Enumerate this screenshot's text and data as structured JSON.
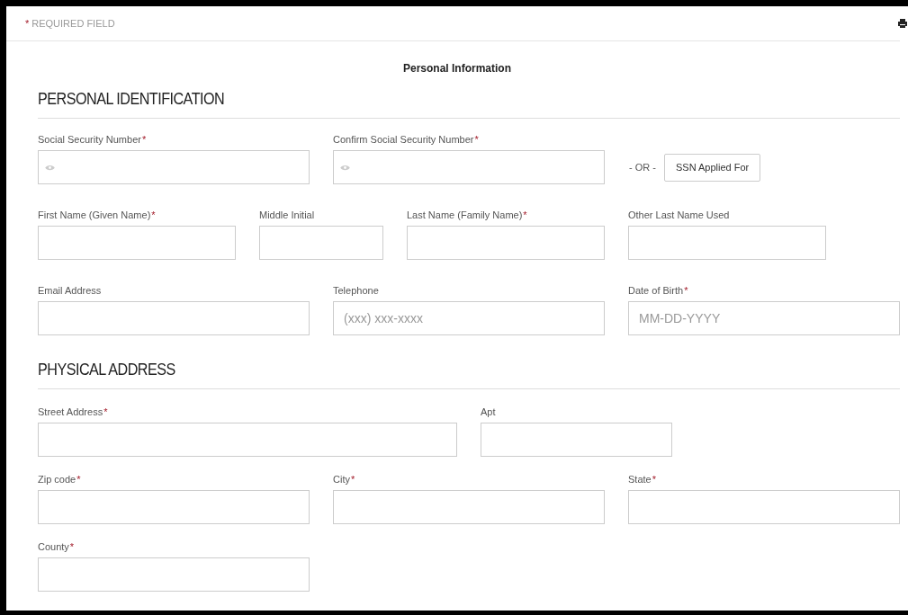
{
  "top_bar": {
    "mark": "*",
    "label": "REQUIRED FIELD"
  },
  "page_title": "Personal Information",
  "sections": [
    {
      "heading": "PERSONAL IDENTIFICATION",
      "rows": [
        [
          {
            "kind": "masked",
            "label": "Social Security Number",
            "mark": "*"
          },
          {
            "kind": "masked",
            "label": "Confirm Social Security Number",
            "mark": "*"
          },
          {
            "kind": "alternative",
            "text": "- OR -",
            "button": "SSN Applied For"
          }
        ],
        [
          {
            "kind": "field",
            "label": "First Name (Given Name)",
            "mark": "*"
          },
          {
            "kind": "field",
            "label": "Middle Initial"
          },
          {
            "kind": "field",
            "label": "Last Name (Family Name)",
            "mark": "*"
          },
          {
            "kind": "field",
            "label": "Other Last Name Used"
          }
        ],
        [
          {
            "kind": "field",
            "label": "Email Address"
          },
          {
            "kind": "field",
            "label": "Telephone",
            "placeholder": "(xxx) xxx-xxxx"
          },
          {
            "kind": "field",
            "label": "Date of Birth",
            "mark": "*",
            "placeholder": "MM-DD-YYYY"
          }
        ]
      ]
    },
    {
      "heading": "PHYSICAL ADDRESS",
      "rows": [
        [
          {
            "kind": "field",
            "label": "Street Address",
            "mark": "*"
          },
          {
            "kind": "field",
            "label": "Apt"
          }
        ],
        [
          {
            "kind": "field",
            "label": "Zip code",
            "mark": "*"
          },
          {
            "kind": "field",
            "label": "City",
            "mark": "*"
          },
          {
            "kind": "field",
            "label": "State",
            "mark": "*"
          }
        ],
        [
          {
            "kind": "field",
            "label": "County",
            "mark": "*"
          }
        ]
      ]
    }
  ]
}
